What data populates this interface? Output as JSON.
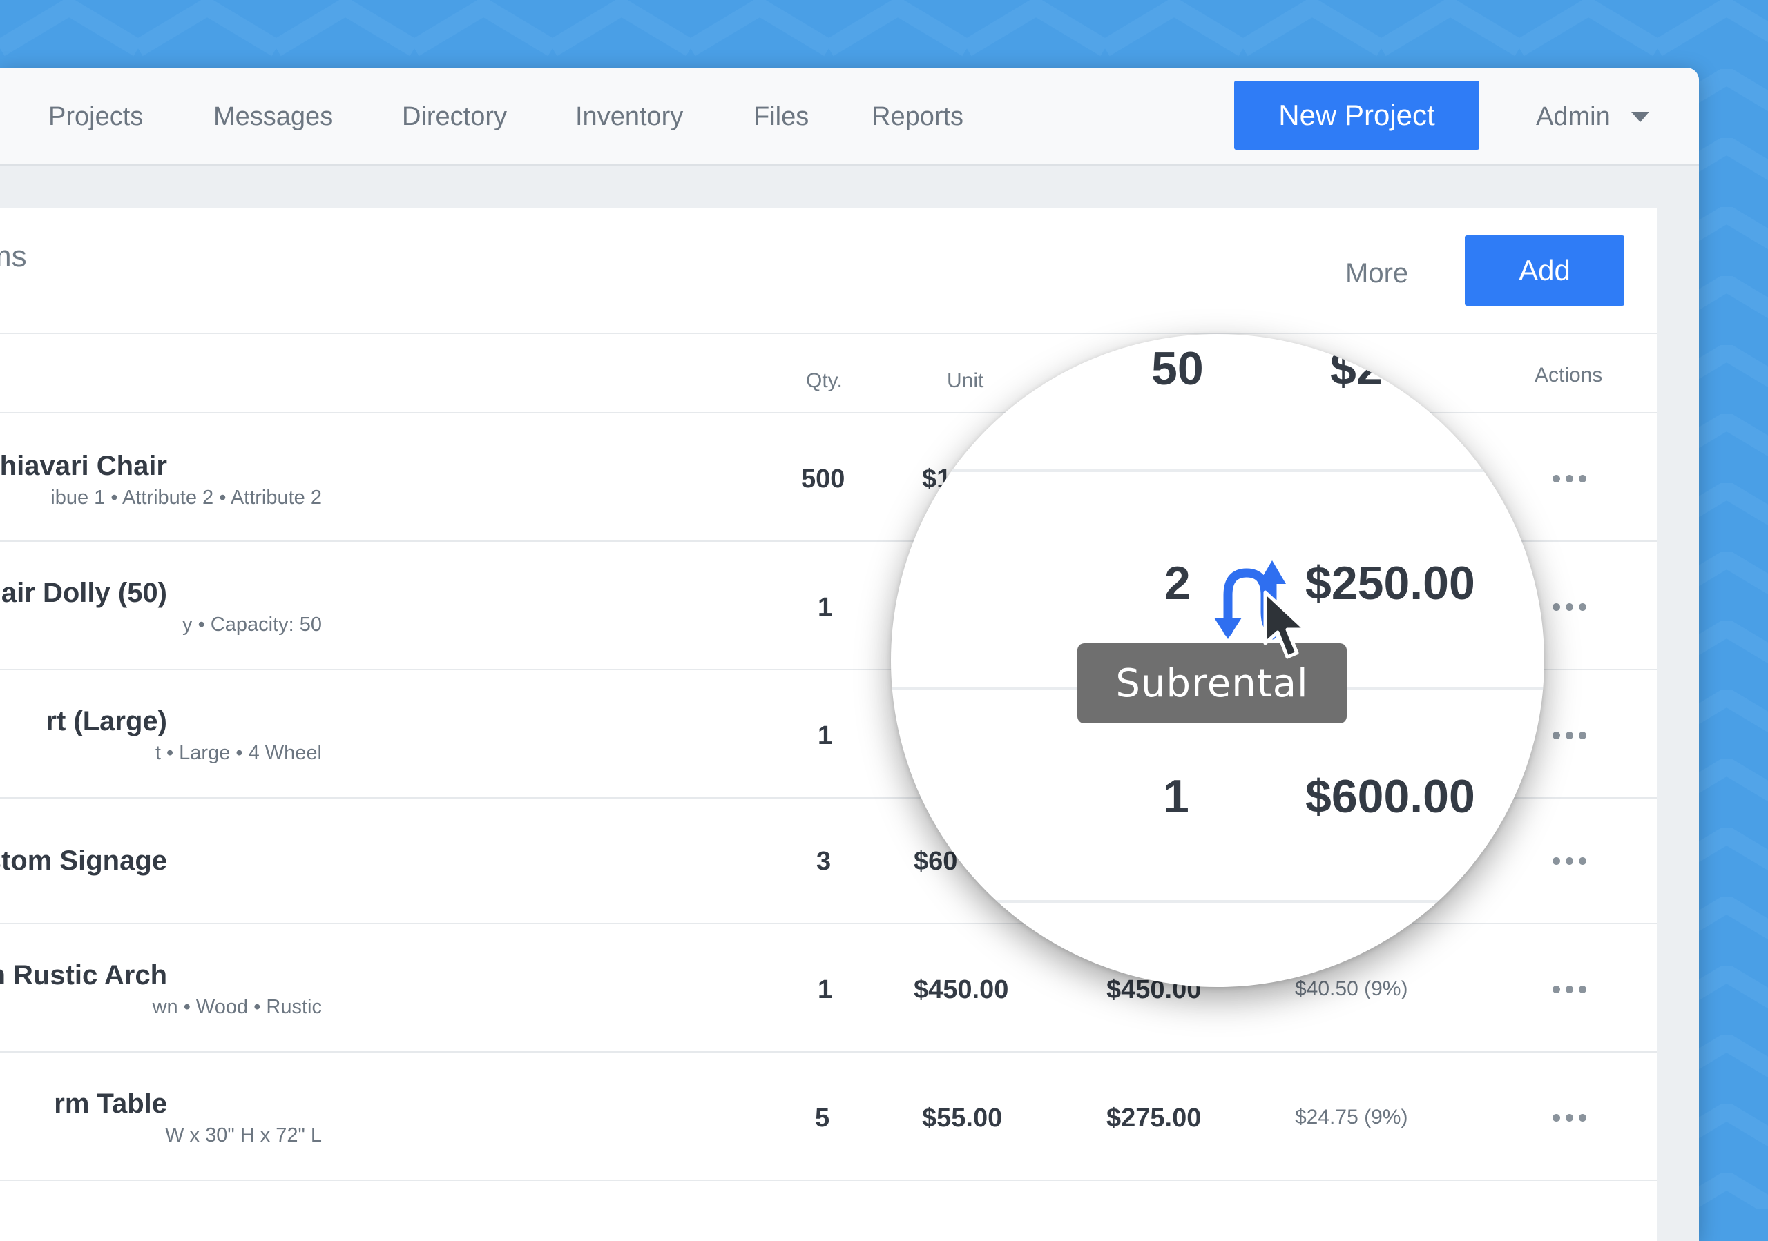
{
  "nav": {
    "links": [
      "Projects",
      "Messages",
      "Directory",
      "Inventory",
      "Files",
      "Reports"
    ],
    "new_project_label": "New Project",
    "admin_label": "Admin"
  },
  "panel": {
    "title": "ms",
    "more_label": "More",
    "add_label": "Add"
  },
  "table": {
    "headers": {
      "qty": "Qty.",
      "unit": "Unit",
      "actions": "Actions"
    },
    "rows": [
      {
        "name": "ite Chiavari Chair",
        "attrs": "ibue 1  •  Attribute 2  •  Attribute 2",
        "qty": "500",
        "unit": "$1",
        "total": "",
        "tax": ""
      },
      {
        "name": "air Dolly (50)",
        "attrs": "y • Capacity: 50",
        "qty": "1",
        "unit": "",
        "total": "",
        "tax": ""
      },
      {
        "name": "rt (Large)",
        "attrs": "t • Large • 4 Wheel",
        "qty": "1",
        "unit": "",
        "total": "",
        "tax": ""
      },
      {
        "name": "stom Signage",
        "attrs": "",
        "qty": "3",
        "unit": "$60",
        "total": "",
        "tax": ""
      },
      {
        "name": "oden Rustic Arch",
        "attrs": "wn • Wood • Rustic",
        "qty": "1",
        "unit": "$450.00",
        "total": "$450.00",
        "tax": "$40.50 (9%)"
      },
      {
        "name": "rm Table",
        "attrs": "W x 30\" H x 72\" L",
        "qty": "5",
        "unit": "$55.00",
        "total": "$275.00",
        "tax": "$24.75 (9%)"
      }
    ]
  },
  "magnifier": {
    "top_qty": "50",
    "top_price": "$2",
    "row1_qty": "2",
    "row1_price": "$250.00",
    "tooltip": "Subrental",
    "row2_qty": "1",
    "row2_price": "$600.00"
  },
  "colors": {
    "accent": "#2f7cf6",
    "background": "#4a9fe6",
    "tooltip": "#6f6f6f"
  },
  "icons": [
    "subrental-icon",
    "cursor-arrow-icon",
    "more-dots-icon",
    "caret-down-icon"
  ]
}
